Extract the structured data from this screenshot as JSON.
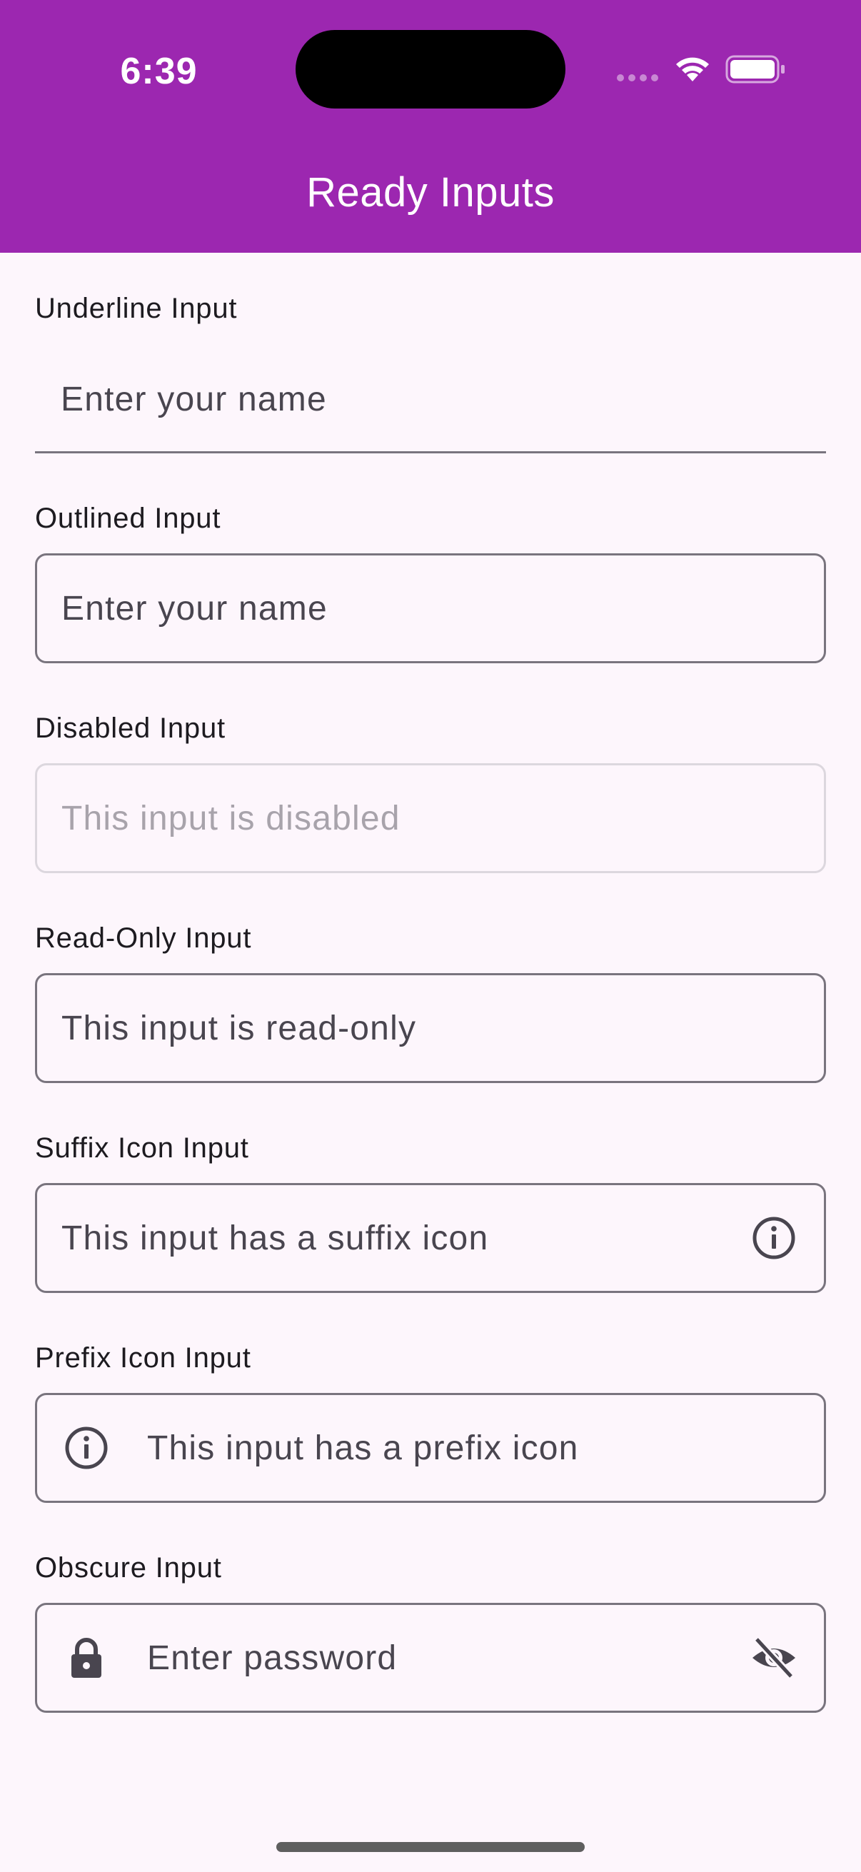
{
  "status_bar": {
    "time": "6:39",
    "icons": [
      "signal-dots",
      "wifi-icon",
      "battery-icon"
    ]
  },
  "app_bar": {
    "title": "Ready Inputs",
    "color": "#9c27b0"
  },
  "fields": {
    "underline": {
      "label": "Underline Input",
      "placeholder": "Enter your name"
    },
    "outlined": {
      "label": "Outlined Input",
      "placeholder": "Enter your name"
    },
    "disabled": {
      "label": "Disabled Input",
      "placeholder": "This input is disabled"
    },
    "readonly": {
      "label": "Read-Only Input",
      "value": "This input is read-only"
    },
    "suffix": {
      "label": "Suffix Icon Input",
      "placeholder": "This input has a suffix icon",
      "icon": "info-icon"
    },
    "prefix": {
      "label": "Prefix Icon Input",
      "placeholder": "This input has a prefix icon",
      "icon": "info-icon"
    },
    "obscure": {
      "label": "Obscure Input",
      "placeholder": "Enter password",
      "prefix_icon": "lock-icon",
      "suffix_icon": "eye-off-icon"
    }
  }
}
